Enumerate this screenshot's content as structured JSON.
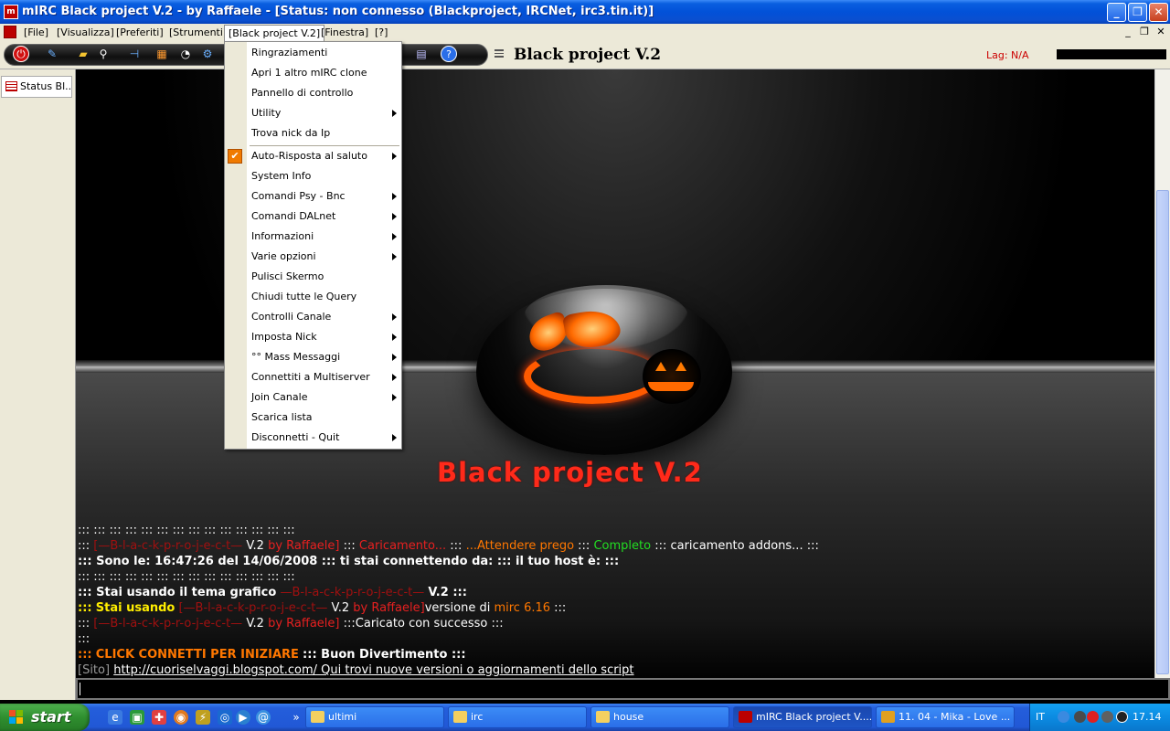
{
  "window": {
    "title": "mIRC Black project V.2 - by Raffaele - [Status: non connesso (Blackproject, IRCNet, irc3.tin.it)]",
    "minimize": "_",
    "maximize": "❐",
    "close": "✕"
  },
  "menubar": {
    "items": [
      "[File]",
      "[Visualizza]",
      "[Preferiti]",
      "[Strumenti]",
      "[Black project V.2]",
      "[Finestra]",
      "[?]"
    ],
    "mdi_minimize": "_",
    "mdi_restore": "❐",
    "mdi_close": "✕"
  },
  "toolbar": {
    "brand": "Black project V.2",
    "lag": "Lag: N/A"
  },
  "switchbar": {
    "window_label": "Status Bl..."
  },
  "dropdown": {
    "items": [
      {
        "label": "Ringraziamenti",
        "submenu": false
      },
      {
        "label": "Apri 1 altro mIRC clone",
        "submenu": false
      },
      {
        "label": "Pannello di controllo",
        "submenu": false
      },
      {
        "label": "Utility",
        "submenu": true
      },
      {
        "label": "Trova nick da Ip",
        "submenu": false
      },
      {
        "label": "Auto-Risposta al saluto",
        "submenu": true,
        "checked": true
      },
      {
        "label": "System Info",
        "submenu": false
      },
      {
        "label": "Comandi Psy - Bnc",
        "submenu": true
      },
      {
        "label": "Comandi DALnet",
        "submenu": true
      },
      {
        "label": "Informazioni",
        "submenu": true
      },
      {
        "label": "Varie opzioni",
        "submenu": true
      },
      {
        "label": "Pulisci Skermo",
        "submenu": false
      },
      {
        "label": "Chiudi tutte le Query",
        "submenu": false
      },
      {
        "label": "Controlli Canale",
        "submenu": true
      },
      {
        "label": "Imposta Nick",
        "submenu": true
      },
      {
        "label": "°° Mass Messaggi",
        "submenu": true
      },
      {
        "label": "Connettiti a Multiserver",
        "submenu": true
      },
      {
        "label": "Join Canale",
        "submenu": true
      },
      {
        "label": "Scarica lista",
        "submenu": false
      },
      {
        "label": "Disconnetti - Quit",
        "submenu": true
      }
    ]
  },
  "main": {
    "logo_text": "Black project V.2",
    "log": {
      "l1": "::: ::: ::: ::: ::: ::: ::: ::: ::: ::: ::: ::: ::: :::",
      "l2": {
        "a": ":::",
        "b": "[—B-l-a-c-k-p-r-o-j-e-c-t—",
        "c": "V.2",
        "d": "by Raffaele]",
        "e": ":::",
        "f": "Caricamento...",
        "g": ":::",
        "h": "...Attendere prego",
        "i": ":::",
        "j": "Completo",
        "k": "::: caricamento addons... :::"
      },
      "l3": "::: Sono le: 16:47:26 del 14/06/2008 ::: ti stai connettendo da: ::: il tuo host è: :::",
      "l4": "::: ::: ::: ::: ::: ::: ::: ::: ::: ::: ::: ::: ::: :::",
      "l5": {
        "a": "::: Stai usando il tema grafico",
        "b": "—B-l-a-c-k-p-r-o-j-e-c-t—",
        "c": "V.2 :::"
      },
      "l6": {
        "a": ":::",
        "b": "Stai usando",
        "c": "[—B-l-a-c-k-p-r-o-j-e-c-t—",
        "d": "V.2",
        "e": "by Raffaele]",
        "f": "versione di",
        "g": "mirc 6.16",
        "h": ":::"
      },
      "l7": {
        "a": ":::",
        "b": "[—B-l-a-c-k-p-r-o-j-e-c-t—",
        "c": "V.2",
        "d": "by Raffaele]",
        "e": ":::Caricato con successo :::"
      },
      "l8": ":::",
      "l9": {
        "a": ":::",
        "b": "CLICK CONNETTI PER INIZIARE",
        "c": "::: Buon Divertimento :::"
      },
      "l10": {
        "a": "[Sito]",
        "b": "http://cuoriselvaggi.blogspot.com/ Qui trovi nuove versioni o aggiornamenti dello script"
      }
    }
  },
  "taskbar": {
    "start": "start",
    "tasks": [
      {
        "label": "ultimi"
      },
      {
        "label": "irc"
      },
      {
        "label": "house"
      },
      {
        "label": "mIRC Black project V...."
      },
      {
        "label": "11. 04 - Mika - Love ..."
      }
    ],
    "lang": "IT",
    "clock": "17.14"
  },
  "icons": {
    "toolbar": [
      "power-icon",
      "connect-icon",
      "folder-icon",
      "search-icon",
      "channel-icon",
      "address-book-icon",
      "timer-icon",
      "options-icon",
      "help-icon"
    ],
    "quicklaunch": [
      "ie-icon",
      "media-icon",
      "msn-icon",
      "firefox-icon",
      "winamp-icon",
      "outlook-icon"
    ]
  },
  "colors": {
    "xp_blue": "#0251d8",
    "accent_red": "#e62020",
    "menu_check": "#f07a00"
  }
}
